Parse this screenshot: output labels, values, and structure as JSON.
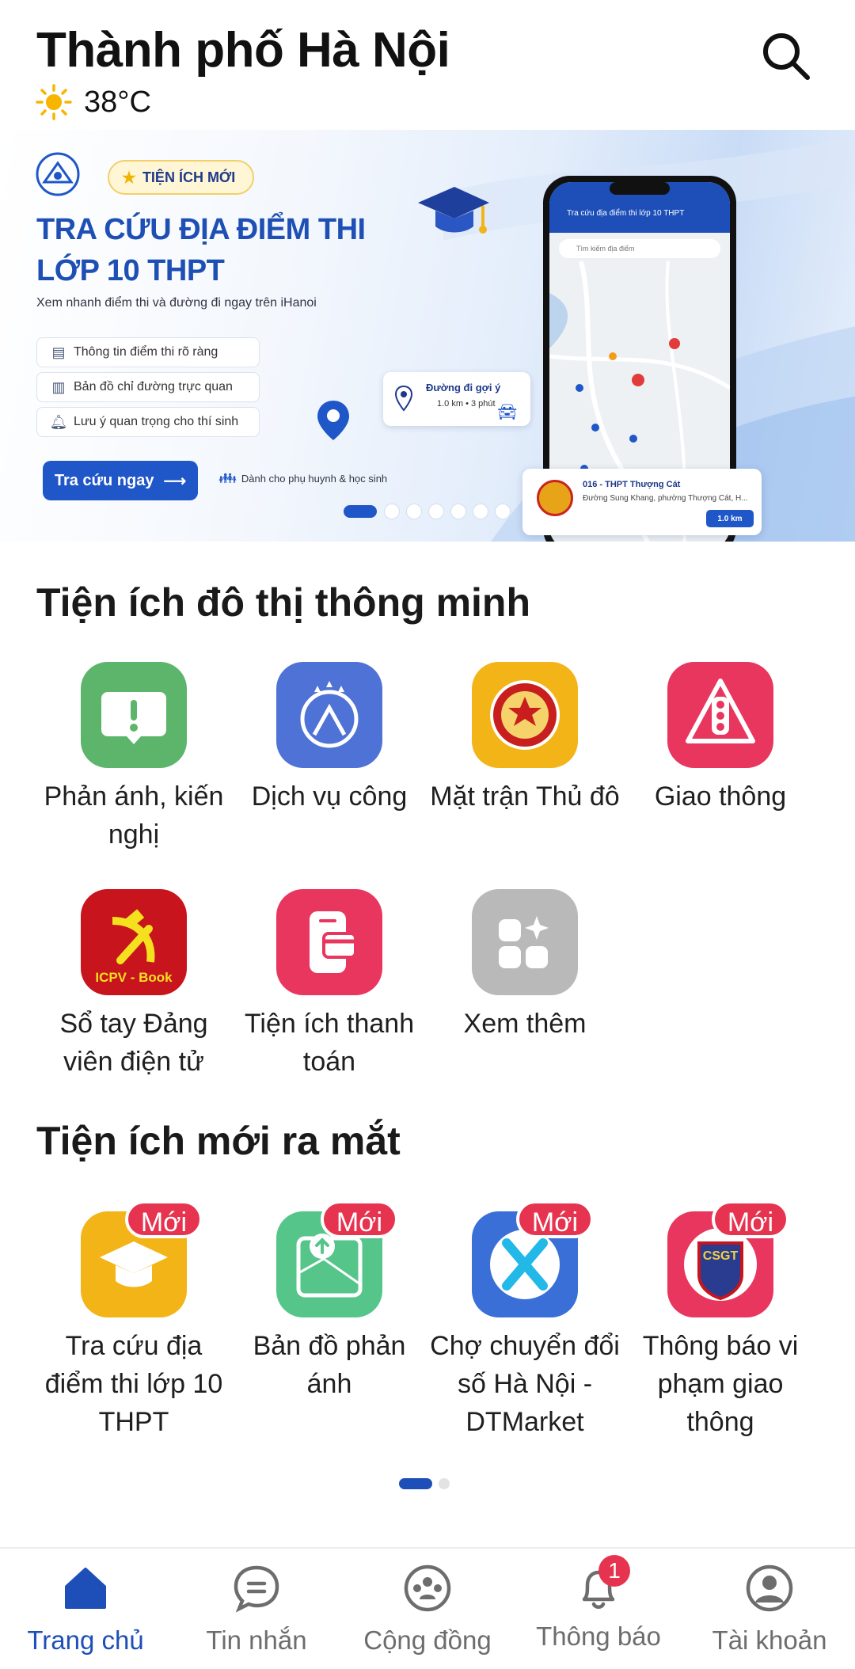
{
  "header": {
    "city": "Thành phố Hà Nội",
    "temperature": "38°C",
    "weather_icon": "sun-icon",
    "search_icon": "search-icon"
  },
  "banner": {
    "tag": "TIỆN ÍCH MỚI",
    "title_line1": "TRA CỨU ĐỊA ĐIỂM THI",
    "title_line2": "LỚP 10 THPT",
    "subtitle": "Xem nhanh điểm thi và đường đi ngay trên iHanoi",
    "features": [
      "Thông tin điểm thi rõ ràng",
      "Bản đồ chỉ đường trực quan",
      "Lưu ý quan trọng cho thí sinh"
    ],
    "cta": "Tra cứu ngay",
    "audience": "Dành cho phụ huynh & học sinh",
    "route_title": "Đường đi gợi ý",
    "route_info": "1.0 km • 3 phút",
    "phone_title": "Tra cứu địa điểm thi lớp 10 THPT",
    "phone_search": "Tìm kiếm địa điểm",
    "place_name": "016 - THPT Thượng Cát",
    "place_address": "Đường Sung Khang, phường Thượng Cát, H...",
    "place_distance": "1.0 km",
    "slides_total": 7,
    "active_slide": 1
  },
  "smart_utilities": {
    "title": "Tiện ích đô thị thông minh",
    "items": [
      {
        "label": "Phản ánh, kiến nghị",
        "icon": "feedback-icon",
        "color": "#5cb56b"
      },
      {
        "label": "Dịch vụ công",
        "icon": "public-service-icon",
        "color": "#4f72d6"
      },
      {
        "label": "Mặt trận Thủ đô",
        "icon": "front-emblem-icon",
        "color": "#f3b417"
      },
      {
        "label": "Giao thông",
        "icon": "traffic-light-icon",
        "color": "#e8365e"
      },
      {
        "label": "Sổ tay Đảng viên điện tử",
        "icon": "party-book-icon",
        "color": "#c8141c",
        "icon_text": "ICPV - Book"
      },
      {
        "label": "Tiện ích thanh toán",
        "icon": "payment-icon",
        "color": "#e8365e"
      },
      {
        "label": "Xem thêm",
        "icon": "more-apps-icon",
        "color": "#b9b9b9"
      }
    ]
  },
  "new_utilities": {
    "title": "Tiện ích mới ra mắt",
    "badge": "Mới",
    "items": [
      {
        "label": "Tra cứu địa điểm thi lớp 10 THPT",
        "icon": "graduation-cap-icon",
        "color": "#f3b417"
      },
      {
        "label": "Bản đồ phản ánh",
        "icon": "map-feedback-icon",
        "color": "#56c58a"
      },
      {
        "label": "Chợ chuyển đổi số Hà Nội - DTMarket",
        "icon": "dtmarket-icon",
        "color": "#3a6fd8"
      },
      {
        "label": "Thông báo vi phạm giao thông",
        "icon": "traffic-police-icon",
        "color": "#e8365e",
        "icon_text": "CSGT"
      }
    ],
    "pages_total": 2,
    "active_page": 1
  },
  "bottom_nav": {
    "items": [
      {
        "label": "Trang chủ",
        "icon": "home-icon",
        "active": true
      },
      {
        "label": "Tin nhắn",
        "icon": "chat-icon"
      },
      {
        "label": "Cộng đồng",
        "icon": "community-icon"
      },
      {
        "label": "Thông báo",
        "icon": "bell-icon",
        "count": "1"
      },
      {
        "label": "Tài khoản",
        "icon": "account-icon"
      }
    ]
  },
  "colors": {
    "primary": "#1e4fb8",
    "badge": "#e6334f",
    "text": "#1f1f1f",
    "muted": "#6d6d6d"
  }
}
